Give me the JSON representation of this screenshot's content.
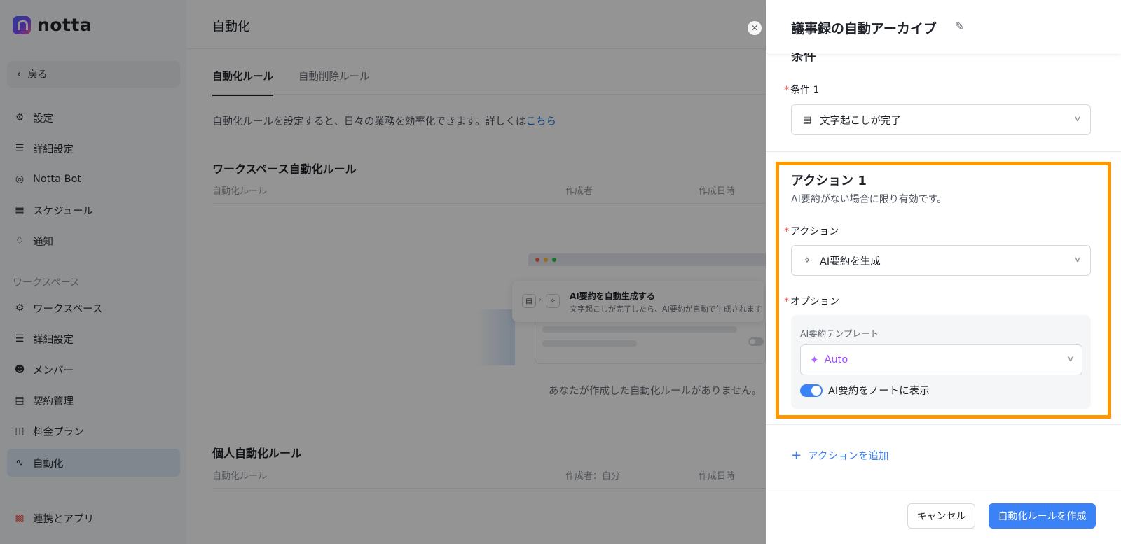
{
  "app": {
    "logo_text": "notta",
    "back_label": "戻る",
    "nav_items": [
      {
        "label": "設定",
        "icon": "gear-icon"
      },
      {
        "label": "詳細設定",
        "icon": "sliders-icon"
      },
      {
        "label": "Notta Bot",
        "icon": "bot-icon"
      },
      {
        "label": "スケジュール",
        "icon": "calendar-icon"
      },
      {
        "label": "通知",
        "icon": "bell-icon"
      }
    ],
    "workspace_section_label": "ワークスペース",
    "workspace_items": [
      {
        "label": "ワークスペース",
        "icon": "gear-icon"
      },
      {
        "label": "詳細設定",
        "icon": "sliders-icon"
      },
      {
        "label": "メンバー",
        "icon": "users-icon"
      },
      {
        "label": "契約管理",
        "icon": "card-icon"
      },
      {
        "label": "料金プラン",
        "icon": "map-icon"
      },
      {
        "label": "自動化",
        "icon": "automation-icon",
        "active": true
      }
    ],
    "integrations_label": "連携とアプリ"
  },
  "main": {
    "title": "自動化",
    "tabs": [
      {
        "label": "自動化ルール",
        "active": true
      },
      {
        "label": "自動削除ルール",
        "active": false
      }
    ],
    "description": "自動化ルールを設定すると、日々の業務を効率化できます。詳しくは",
    "description_link": "こちら",
    "workspace_rules": {
      "title": "ワークスペース自動化ルール",
      "columns": [
        "自動化ルール",
        "作成者",
        "作成日時"
      ]
    },
    "illustration": {
      "card_title": "AI要約を自動生成する",
      "card_subtitle": "文字起こしが完了したら、AI要約が自動で生成されます"
    },
    "empty_text": "あなたが作成した自動化ルールがありません。",
    "personal_rules": {
      "title": "個人自動化ルール",
      "columns": [
        "自動化ルール",
        "作成者：自分",
        "作成日時"
      ]
    }
  },
  "drawer": {
    "title": "議事録の自動アーカイブ",
    "partial_heading": "条件",
    "condition": {
      "label": "条件 1",
      "value": "文字起こしが完了"
    },
    "action": {
      "title": "アクション 1",
      "subtitle": "AI要約がない場合に限り有効です。",
      "action_label": "アクション",
      "action_value": "AI要約を生成",
      "options_label": "オプション",
      "template_label": "AI要約テンプレート",
      "template_value": "Auto",
      "toggle_label": "AI要約をノートに表示",
      "toggle_on": true
    },
    "add_action_label": "アクションを追加",
    "cancel_label": "キャンセル",
    "create_label": "自動化ルールを作成"
  },
  "colors": {
    "highlight_border": "#ff9800",
    "primary": "#3b82f6",
    "required": "#f54a45",
    "active_nav": "#dce8f6"
  }
}
